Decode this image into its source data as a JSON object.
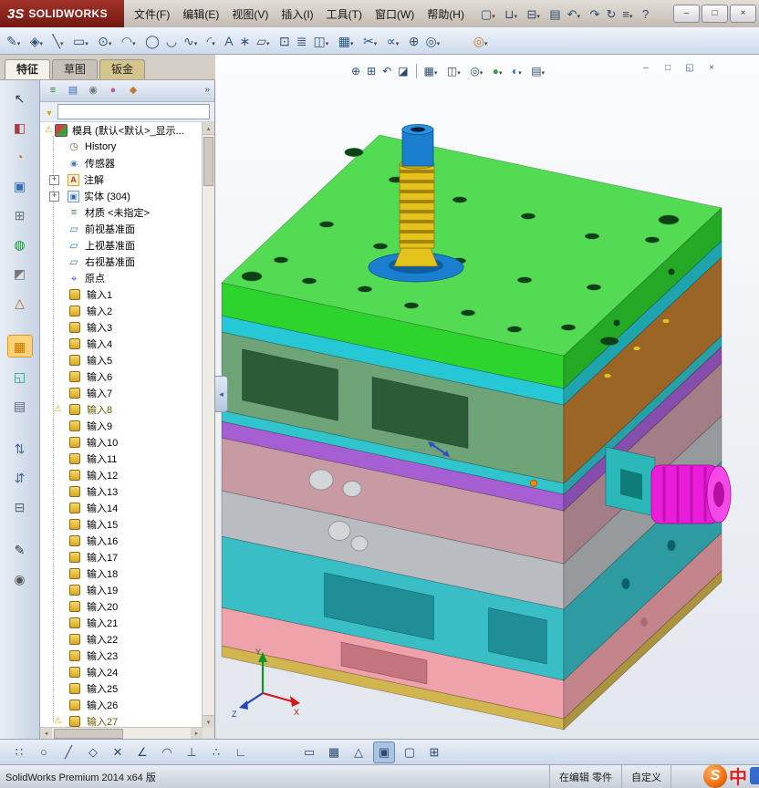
{
  "titlebar": {
    "logo_prefix": "3S",
    "logo_text": "SOLIDWORKS",
    "menus": [
      "文件(F)",
      "编辑(E)",
      "视图(V)",
      "插入(I)",
      "工具(T)",
      "窗口(W)",
      "帮助(H)"
    ],
    "tools": [
      {
        "name": "new-button",
        "glyph": "▢",
        "caret": true
      },
      {
        "name": "open-button",
        "glyph": "⊔",
        "caret": true
      },
      {
        "name": "save-button",
        "glyph": "⊟",
        "caret": true
      },
      {
        "name": "print-button",
        "glyph": "▤"
      },
      {
        "name": "undo-button",
        "glyph": "↶",
        "caret": true
      },
      {
        "name": "redo-button",
        "glyph": "↷"
      },
      {
        "name": "rebuild-button",
        "glyph": "↻"
      },
      {
        "name": "options-button",
        "glyph": "≡",
        "caret": true
      },
      {
        "name": "help-button",
        "glyph": "?"
      }
    ],
    "window_controls": [
      {
        "name": "minimize-button",
        "glyph": "–"
      },
      {
        "name": "maximize-button",
        "glyph": "□"
      },
      {
        "name": "close-button",
        "glyph": "×"
      }
    ]
  },
  "toolbar2": [
    {
      "name": "sketch-button",
      "glyph": "✎",
      "caret": true
    },
    {
      "name": "smart-dimension-button",
      "glyph": "◈",
      "caret": true
    },
    {
      "name": "line-button",
      "glyph": "╲",
      "caret": true
    },
    {
      "name": "rectangle-button",
      "glyph": "▭",
      "caret": true
    },
    {
      "name": "circle-button",
      "glyph": "⊙",
      "caret": true
    },
    {
      "name": "arc-button",
      "glyph": "◠",
      "caret": true
    },
    {
      "name": "ellipse-button",
      "glyph": "◯"
    },
    {
      "name": "slot-button",
      "glyph": "◡"
    },
    {
      "name": "spline-button",
      "glyph": "∿",
      "caret": true
    },
    {
      "name": "fillet-button",
      "glyph": "◜",
      "caret": true
    },
    {
      "name": "text-button",
      "glyph": "A"
    },
    {
      "name": "point-button",
      "glyph": "∗"
    },
    {
      "name": "plane-button",
      "glyph": "▱",
      "caret": true
    },
    {
      "name": "convert-entities-button",
      "glyph": "⊡"
    },
    {
      "name": "offset-entities-button",
      "glyph": "≣"
    },
    {
      "name": "mirror-entities-button",
      "glyph": "◫",
      "caret": true
    },
    {
      "name": "linear-pattern-button",
      "glyph": "▦",
      "caret": true
    },
    {
      "name": "trim-entities-button",
      "glyph": "✂",
      "caret": true
    },
    {
      "name": "display-relations-button",
      "glyph": "∝",
      "caret": true
    },
    {
      "name": "repair-sketch-button",
      "glyph": "⊕"
    },
    {
      "name": "quick-snaps-button",
      "glyph": "◎",
      "caret": true
    },
    {
      "name": "selection-filter-button",
      "glyph": "◎",
      "cls": "far",
      "color": "#c87820",
      "caret": true
    }
  ],
  "tabs": [
    {
      "name": "tab-features",
      "label": "特征",
      "cls": "active"
    },
    {
      "name": "tab-sketch",
      "label": "草图"
    },
    {
      "name": "tab-sheetmetal",
      "label": "钣金",
      "cls": "sheetmetal"
    }
  ],
  "left_toolbar": [
    {
      "name": "select-tool",
      "glyph": "↖",
      "color": "#333333"
    },
    {
      "name": "left-tool-2",
      "glyph": "◧",
      "color": "#a04040"
    },
    {
      "name": "left-tool-3",
      "glyph": "◔",
      "color": "#b8860b"
    },
    {
      "name": "left-tool-4",
      "glyph": "▣",
      "color": "#3a6ab8"
    },
    {
      "name": "left-tool-5",
      "glyph": "⊞",
      "color": "#667788"
    },
    {
      "name": "left-tool-6",
      "glyph": "◍",
      "color": "#2a8a4a"
    },
    {
      "name": "left-tool-7",
      "glyph": "◩",
      "color": "#777777"
    },
    {
      "name": "left-tool-8",
      "glyph": "△",
      "color": "#aa6620"
    },
    {
      "name": "left-tool-9",
      "glyph": "▦",
      "color": "#cc7700",
      "cls": "grp active"
    },
    {
      "name": "left-tool-10",
      "glyph": "◱",
      "color": "#2a9a8a"
    },
    {
      "name": "left-tool-11",
      "glyph": "▤",
      "color": "#556677"
    },
    {
      "name": "left-tool-12",
      "glyph": "⇅",
      "color": "#3a6ab8",
      "cls": "grp"
    },
    {
      "name": "left-tool-13",
      "glyph": "⇵",
      "color": "#3a6ab8"
    },
    {
      "name": "left-tool-14",
      "glyph": "⊟",
      "color": "#556677"
    },
    {
      "name": "left-tool-15",
      "glyph": "✎",
      "color": "#333333",
      "cls": "grp"
    },
    {
      "name": "left-tool-16",
      "glyph": "◉",
      "color": "#555555"
    }
  ],
  "tree_panel": {
    "manager_tabs": [
      {
        "name": "featuremanager-tab",
        "glyph": "≡",
        "color": "#2a7a2a"
      },
      {
        "name": "propertymanager-tab",
        "glyph": "▤",
        "color": "#3a6ab8"
      },
      {
        "name": "configurationmanager-tab",
        "glyph": "◉",
        "color": "#777777"
      },
      {
        "name": "displaymanager-tab",
        "glyph": "●",
        "color": "#c05a9a"
      },
      {
        "name": "dimxpertmanager-tab",
        "glyph": "◆",
        "color": "#c07a2a"
      }
    ],
    "filter_value": ""
  },
  "feature_tree": {
    "root_label": "模具 (默认<默认>_显示...",
    "items": [
      {
        "label": "History",
        "icon": "history"
      },
      {
        "label": "传感器",
        "icon": "sensor"
      },
      {
        "label": "注解",
        "icon": "annotation",
        "expand": true
      },
      {
        "label": "实体 (304)",
        "icon": "solids",
        "expand": true
      },
      {
        "label": "材质 <未指定>",
        "icon": "material"
      },
      {
        "label": "前视基准面",
        "icon": "plane"
      },
      {
        "label": "上视基准面",
        "icon": "plane"
      },
      {
        "label": "右视基准面",
        "icon": "plane"
      },
      {
        "label": "原点",
        "icon": "origin"
      },
      {
        "label": "输入1",
        "icon": "imported"
      },
      {
        "label": "输入2",
        "icon": "imported"
      },
      {
        "label": "输入3",
        "icon": "imported"
      },
      {
        "label": "输入4",
        "icon": "imported"
      },
      {
        "label": "输入5",
        "icon": "imported"
      },
      {
        "label": "输入6",
        "icon": "imported"
      },
      {
        "label": "输入7",
        "icon": "imported"
      },
      {
        "label": "输入8",
        "icon": "imported",
        "warning": true
      },
      {
        "label": "输入9",
        "icon": "imported"
      },
      {
        "label": "输入10",
        "icon": "imported"
      },
      {
        "label": "输入11",
        "icon": "imported"
      },
      {
        "label": "输入12",
        "icon": "imported"
      },
      {
        "label": "输入13",
        "icon": "imported"
      },
      {
        "label": "输入14",
        "icon": "imported"
      },
      {
        "label": "输入15",
        "icon": "imported"
      },
      {
        "label": "输入16",
        "icon": "imported"
      },
      {
        "label": "输入17",
        "icon": "imported"
      },
      {
        "label": "输入18",
        "icon": "imported"
      },
      {
        "label": "输入19",
        "icon": "imported"
      },
      {
        "label": "输入20",
        "icon": "imported"
      },
      {
        "label": "输入21",
        "icon": "imported"
      },
      {
        "label": "输入22",
        "icon": "imported"
      },
      {
        "label": "输入23",
        "icon": "imported"
      },
      {
        "label": "输入24",
        "icon": "imported"
      },
      {
        "label": "输入25",
        "icon": "imported"
      },
      {
        "label": "输入26",
        "icon": "imported"
      },
      {
        "label": "输入27",
        "icon": "imported",
        "warning": true
      }
    ]
  },
  "headsup": [
    {
      "name": "zoom-fit-button",
      "glyph": "⊕"
    },
    {
      "name": "zoom-area-button",
      "glyph": "⊞"
    },
    {
      "name": "previous-view-button",
      "glyph": "↶"
    },
    {
      "name": "section-view-button",
      "glyph": "◪"
    },
    {
      "cls": "hud-sep-item"
    },
    {
      "name": "view-orientation-button",
      "glyph": "▦",
      "caret": true
    },
    {
      "name": "display-style-button",
      "glyph": "◫",
      "caret": true
    },
    {
      "name": "hide-show-items-button",
      "glyph": "◎",
      "caret": true
    },
    {
      "name": "edit-appearance-button",
      "glyph": "●",
      "color": "#3aa04a",
      "caret": true
    },
    {
      "name": "apply-scene-button",
      "glyph": "◐",
      "color": "#2a6dc8",
      "caret": true
    },
    {
      "name": "view-settings-button",
      "glyph": "▤",
      "caret": true
    }
  ],
  "doc_controls": [
    {
      "name": "doc-minimize-button",
      "glyph": "–"
    },
    {
      "name": "doc-maximize-button",
      "glyph": "□"
    },
    {
      "name": "doc-restore-button",
      "glyph": "◱"
    },
    {
      "name": "doc-close-button",
      "glyph": "×"
    }
  ],
  "bottom_toolbar": [
    {
      "name": "snap-points-button",
      "glyph": "∷"
    },
    {
      "name": "snap-center-button",
      "glyph": "○"
    },
    {
      "name": "snap-line-button",
      "glyph": "╱"
    },
    {
      "name": "snap-quadrant-button",
      "glyph": "◇"
    },
    {
      "name": "snap-intersection-button",
      "glyph": "✕"
    },
    {
      "name": "snap-angle-button",
      "glyph": "∠"
    },
    {
      "name": "snap-arc-button",
      "glyph": "◠"
    },
    {
      "name": "snap-perpendicular-button",
      "glyph": "⊥"
    },
    {
      "name": "snap-tangent-button",
      "glyph": "∴"
    },
    {
      "name": "snap-grid-button",
      "glyph": "∟"
    },
    {
      "name": "view-toggle-1",
      "glyph": "▭",
      "cls": "gap-l"
    },
    {
      "name": "view-toggle-2",
      "glyph": "▦"
    },
    {
      "name": "view-toggle-3",
      "glyph": "△"
    },
    {
      "name": "view-toggle-4",
      "glyph": "▣",
      "cls": "active"
    },
    {
      "name": "view-toggle-5",
      "glyph": "▢"
    },
    {
      "name": "view-toggle-6",
      "glyph": "⊞"
    }
  ],
  "viewport": {
    "triad": {
      "x": "X",
      "y": "Y",
      "z": "Z"
    }
  },
  "statusbar": {
    "product": "SolidWorks Premium 2014 x64 版",
    "editing": "在编辑 零件",
    "customize": "自定义"
  },
  "watermark": {
    "logo": "S",
    "text": "中"
  },
  "colors": {
    "top_plate": "#2ed42e",
    "cyan_plate": "#25c8d4",
    "cavity_front": "#6fa378",
    "cavity_right": "#b5762c",
    "cavity_pocket": "#2c5b38",
    "thin_cyan": "#30c4cc",
    "purple_plate": "#a55fd2",
    "mauve_plate": "#c79aa4",
    "gray_plate": "#b9bcc0",
    "teal_block": "#39bec6",
    "pink_plate": "#f0a2aa",
    "base_strip": "#d2b54e",
    "sprue_blue": "#1b7fd0",
    "thread_yellow": "#e4c41c",
    "knob_magenta": "#ea1ed8",
    "bracket_teal": "#2ab8b8"
  }
}
